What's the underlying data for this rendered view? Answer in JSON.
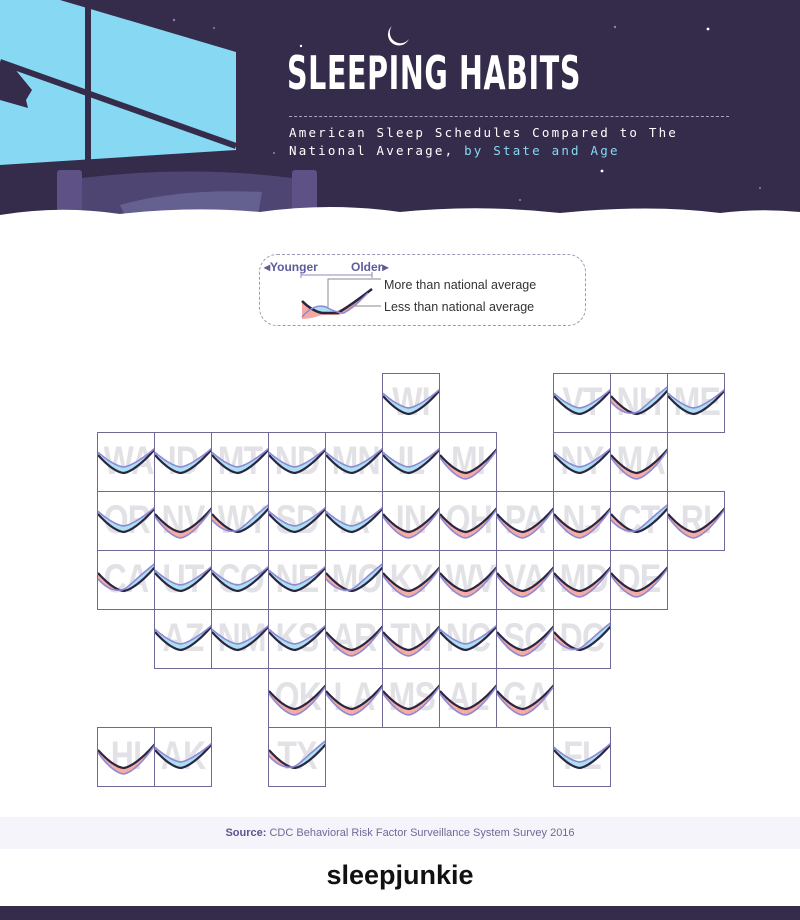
{
  "header": {
    "title": "SLEEPING HABITS",
    "subtitle_main": "American Sleep Schedules Compared to The National Average, ",
    "subtitle_highlight": "by State and Age"
  },
  "legend": {
    "younger": "◂Younger",
    "older": "Older▸",
    "more": "More than national average",
    "less": "Less than national average"
  },
  "colors": {
    "background_dark": "#352c4b",
    "window": "#87d8f2",
    "more_fill": "#a8e0f2",
    "less_fill": "#f5a9a1",
    "national_line": "#2b2540",
    "state_line": "#8d89d6"
  },
  "states": [
    {
      "abbr": "WI",
      "col": 5,
      "row": 0,
      "vs_national": "more"
    },
    {
      "abbr": "VT",
      "col": 8,
      "row": 0,
      "vs_national": "more"
    },
    {
      "abbr": "NH",
      "col": 9,
      "row": 0,
      "vs_national": "mixed"
    },
    {
      "abbr": "ME",
      "col": 10,
      "row": 0,
      "vs_national": "more"
    },
    {
      "abbr": "WA",
      "col": 0,
      "row": 1,
      "vs_national": "more"
    },
    {
      "abbr": "ID",
      "col": 1,
      "row": 1,
      "vs_national": "more"
    },
    {
      "abbr": "MT",
      "col": 2,
      "row": 1,
      "vs_national": "more"
    },
    {
      "abbr": "ND",
      "col": 3,
      "row": 1,
      "vs_national": "more"
    },
    {
      "abbr": "MN",
      "col": 4,
      "row": 1,
      "vs_national": "more"
    },
    {
      "abbr": "IL",
      "col": 5,
      "row": 1,
      "vs_national": "more"
    },
    {
      "abbr": "MI",
      "col": 6,
      "row": 1,
      "vs_national": "less"
    },
    {
      "abbr": "NY",
      "col": 8,
      "row": 1,
      "vs_national": "more"
    },
    {
      "abbr": "MA",
      "col": 9,
      "row": 1,
      "vs_national": "less"
    },
    {
      "abbr": "OR",
      "col": 0,
      "row": 2,
      "vs_national": "more"
    },
    {
      "abbr": "NV",
      "col": 1,
      "row": 2,
      "vs_national": "less"
    },
    {
      "abbr": "WY",
      "col": 2,
      "row": 2,
      "vs_national": "mixed"
    },
    {
      "abbr": "SD",
      "col": 3,
      "row": 2,
      "vs_national": "more"
    },
    {
      "abbr": "IA",
      "col": 4,
      "row": 2,
      "vs_national": "more"
    },
    {
      "abbr": "IN",
      "col": 5,
      "row": 2,
      "vs_national": "less"
    },
    {
      "abbr": "OH",
      "col": 6,
      "row": 2,
      "vs_national": "less"
    },
    {
      "abbr": "PA",
      "col": 7,
      "row": 2,
      "vs_national": "less"
    },
    {
      "abbr": "NJ",
      "col": 8,
      "row": 2,
      "vs_national": "less"
    },
    {
      "abbr": "CT",
      "col": 9,
      "row": 2,
      "vs_national": "mixed"
    },
    {
      "abbr": "RI",
      "col": 10,
      "row": 2,
      "vs_national": "less"
    },
    {
      "abbr": "CA",
      "col": 0,
      "row": 3,
      "vs_national": "mixed"
    },
    {
      "abbr": "UT",
      "col": 1,
      "row": 3,
      "vs_national": "more"
    },
    {
      "abbr": "CO",
      "col": 2,
      "row": 3,
      "vs_national": "more"
    },
    {
      "abbr": "NE",
      "col": 3,
      "row": 3,
      "vs_national": "more"
    },
    {
      "abbr": "MO",
      "col": 4,
      "row": 3,
      "vs_national": "mixed"
    },
    {
      "abbr": "KY",
      "col": 5,
      "row": 3,
      "vs_national": "less"
    },
    {
      "abbr": "WV",
      "col": 6,
      "row": 3,
      "vs_national": "less"
    },
    {
      "abbr": "VA",
      "col": 7,
      "row": 3,
      "vs_national": "less"
    },
    {
      "abbr": "MD",
      "col": 8,
      "row": 3,
      "vs_national": "less"
    },
    {
      "abbr": "DE",
      "col": 9,
      "row": 3,
      "vs_national": "less"
    },
    {
      "abbr": "AZ",
      "col": 1,
      "row": 4,
      "vs_national": "more"
    },
    {
      "abbr": "NM",
      "col": 2,
      "row": 4,
      "vs_national": "more"
    },
    {
      "abbr": "KS",
      "col": 3,
      "row": 4,
      "vs_national": "more"
    },
    {
      "abbr": "AR",
      "col": 4,
      "row": 4,
      "vs_national": "less"
    },
    {
      "abbr": "TN",
      "col": 5,
      "row": 4,
      "vs_national": "less"
    },
    {
      "abbr": "NC",
      "col": 6,
      "row": 4,
      "vs_national": "more"
    },
    {
      "abbr": "SC",
      "col": 7,
      "row": 4,
      "vs_national": "less"
    },
    {
      "abbr": "DC",
      "col": 8,
      "row": 4,
      "vs_national": "mixed"
    },
    {
      "abbr": "OK",
      "col": 3,
      "row": 5,
      "vs_national": "less"
    },
    {
      "abbr": "LA",
      "col": 4,
      "row": 5,
      "vs_national": "less"
    },
    {
      "abbr": "MS",
      "col": 5,
      "row": 5,
      "vs_national": "less"
    },
    {
      "abbr": "AL",
      "col": 6,
      "row": 5,
      "vs_national": "less"
    },
    {
      "abbr": "GA",
      "col": 7,
      "row": 5,
      "vs_national": "less"
    },
    {
      "abbr": "HI",
      "col": 0,
      "row": 6,
      "vs_national": "less"
    },
    {
      "abbr": "AK",
      "col": 1,
      "row": 6,
      "vs_national": "more"
    },
    {
      "abbr": "TX",
      "col": 3,
      "row": 6,
      "vs_national": "mixed"
    },
    {
      "abbr": "FL",
      "col": 8,
      "row": 6,
      "vs_national": "more"
    }
  ],
  "footer": {
    "source_label": "Source:",
    "source_text": "CDC Behavioral Risk Factor Surveillance System Survey 2016",
    "brand": "sleepjunkie"
  }
}
